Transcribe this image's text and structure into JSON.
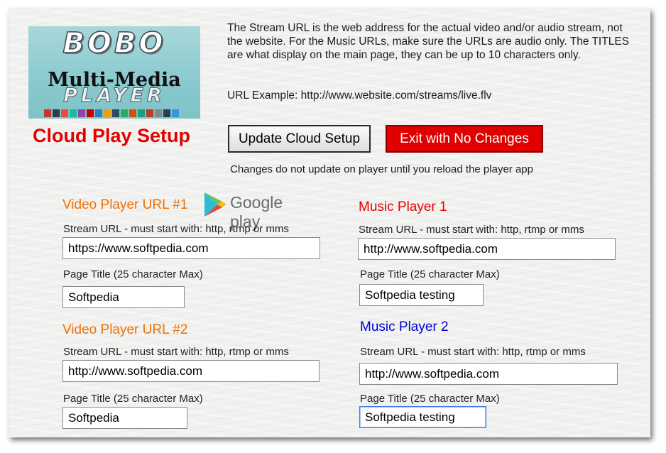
{
  "logo": {
    "line1": "BOBO",
    "line2": "Multi-Media",
    "line3": "PLAYER"
  },
  "description": "The Stream URL is the web address for the actual video and/or audio stream, not the website. For the Music URLs, make sure the URLs are audio only. The TITLES are what display on the main page, they can be up to 10 characters only.",
  "url_example": "URL Example:  http://www.website.com/streams/live.flv",
  "page_title": "Cloud Play Setup",
  "buttons": {
    "update": "Update Cloud Setup",
    "exit": "Exit with No Changes"
  },
  "note": "Changes do not update on player until you reload the player app",
  "google_play": {
    "label": "Google play"
  },
  "sections": {
    "video1": {
      "heading": "Video Player URL #1",
      "stream_label": "Stream URL - must start with:  http, rtmp or mms",
      "stream_value": "https://www.softpedia.com",
      "title_label": "Page Title (25 character Max)",
      "title_value": "Softpedia"
    },
    "video2": {
      "heading": "Video Player  URL #2",
      "stream_label": "Stream URL - must start with:  http, rtmp or mms",
      "stream_value": "http://www.softpedia.com",
      "title_label": "Page Title (25 character Max)",
      "title_value": "Softpedia"
    },
    "music1": {
      "heading": "Music Player 1",
      "stream_label": "Stream URL - must start with:  http, rtmp or mms",
      "stream_value": "http://www.softpedia.com",
      "title_label": "Page Title (25 character Max)",
      "title_value": "Softpedia testing"
    },
    "music2": {
      "heading": "Music Player 2",
      "stream_label": "Stream URL - must start with:  http, rtmp or mms",
      "stream_value": "http://www.softpedia.com",
      "title_label": "Page Title (25 character Max)",
      "title_value": "Softpedia testing"
    }
  },
  "colors": {
    "title_red": "#e60000",
    "video_heading_orange": "#f07000",
    "music1_heading_red": "#e60000",
    "music2_heading_blue": "#0000dd",
    "exit_button": "#e00000"
  }
}
